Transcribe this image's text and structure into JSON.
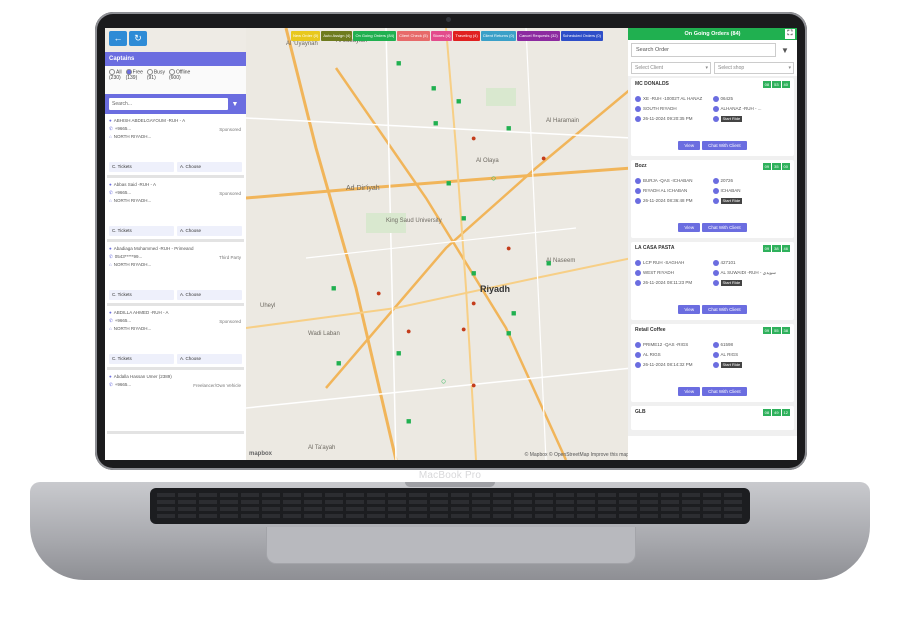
{
  "device": {
    "brand_label": "MacBook Pro"
  },
  "left_panel": {
    "back_icon": "arrow-left-icon",
    "refresh_icon": "refresh-icon",
    "title": "Captains",
    "filters": [
      {
        "label": "All",
        "count": "(230)"
      },
      {
        "label": "Free",
        "count": "(139)"
      },
      {
        "label": "Busy",
        "count": "(91)"
      },
      {
        "label": "Offline",
        "count": "(600)"
      }
    ],
    "search_placeholder": "Search...",
    "captains": [
      {
        "name": "ABHISH ABDELGAYOUM -RUH - A",
        "phone": "+9665...",
        "area": "NORTH RIYADH...",
        "right": "Sponsored",
        "action1": "C. Tickets",
        "action2": "A. Choose"
      },
      {
        "name": "Abbas Said -RUH - A",
        "phone": "+9665...",
        "area": "NORTH RIYADH...",
        "right": "Sponsored",
        "action1": "C. Tickets",
        "action2": "A. Choose"
      },
      {
        "name": "Abadiaga Mohammed -RUH - Primeand",
        "phone": "0543*****99...",
        "area": "NORTH RIYADH...",
        "right": "Third Party",
        "action1": "C. Tickets",
        "action2": "A. Choose"
      },
      {
        "name": "ABDILLA AHMED -RUH - A",
        "phone": "+9665...",
        "area": "NORTH RIYADH...",
        "right": "Sponsored",
        "action1": "C. Tickets",
        "action2": "A. Choose"
      },
      {
        "name": "Abdalla Hassan Umer (2389)",
        "phone": "+9665...",
        "area": "",
        "right": "Freelancer/Own Vehicle",
        "action1": "",
        "action2": ""
      }
    ]
  },
  "status_tabs": [
    {
      "label": "New Order (0)",
      "color": "#e8c81e"
    },
    {
      "label": "Auto Assign (4)",
      "color": "#6e7b1e"
    },
    {
      "label": "On Going Orders (84)",
      "color": "#20b050"
    },
    {
      "label": "Client Check (5)",
      "color": "#e76a6a"
    },
    {
      "label": "Stores (4)",
      "color": "#e34c8c"
    },
    {
      "label": "Traveling (4)",
      "color": "#e02020"
    },
    {
      "label": "Client Returns (0)",
      "color": "#3aa0c8"
    },
    {
      "label": "Cancel Requests (32)",
      "color": "#8c2aa0"
    },
    {
      "label": "Scheduled Orders (0)",
      "color": "#2e4ec8"
    }
  ],
  "map": {
    "city_label": "Riyadh",
    "place_labels": [
      "Al 'Uyaynah",
      "Al Jubaylah",
      "Ad Dir'iyah",
      "King Saud University",
      "Wadi Laban",
      "Al Ta'ayah",
      "Uheyl",
      "Al Haramain",
      "Al Olaya",
      "Al Naseem"
    ],
    "attribution": "© Mapbox © OpenStreetMap Improve this map",
    "logo": "mapbox"
  },
  "right_panel": {
    "title": "On Going Orders (84)",
    "fullscreen_icon": "fullscreen-icon",
    "search_placeholder": "Search Order",
    "filter_icon": "filter-icon",
    "select_client": "Select Client",
    "select_shop": "Select shop",
    "orders": [
      {
        "name": "MC DONALDS",
        "badges": [
          "08",
          "53",
          "40"
        ],
        "c1": "XE -RUH -10002T AL HANAZ",
        "c2": "06425",
        "c3": "SOUTH RIYADH",
        "c4": "ALHANAZ -RUH - ...",
        "c5": "26-11-2024 09:20:35 PM",
        "c6": "Start Ride",
        "view": "View",
        "chat": "Chat With Client"
      },
      {
        "name": "Bozz",
        "badges": [
          "09",
          "35",
          "00"
        ],
        "c1": "BURJA -QAS -ICHABAN",
        "c2": "20726",
        "c3": "RIYADH AL ICHABAN",
        "c4": "ICHABAN",
        "c5": "26-11-2024 08:36:48 PM",
        "c6": "Start Ride",
        "view": "View",
        "chat": "Chat With Client"
      },
      {
        "name": "LA CASA PASTA",
        "badges": [
          "09",
          "38",
          "46"
        ],
        "c1": "LCP RUH -SAGHAH",
        "c2": "427101",
        "c3": "WEST RIYADH",
        "c4": "AL SUWAIDI -RUH - سويدي",
        "c5": "26-11-2024 08:11:23 PM",
        "c6": "Start Ride",
        "view": "View",
        "chat": "Chat With Client"
      },
      {
        "name": "Retail Coffee",
        "badges": [
          "09",
          "55",
          "38"
        ],
        "c1": "PRIME12 -QAS -RIGS",
        "c2": "61598",
        "c3": "AL RIGS",
        "c4": "AL RIGS",
        "c5": "26-11-2024 08:14:32 PM",
        "c6": "Start Ride",
        "view": "View",
        "chat": "Chat With Client"
      },
      {
        "name": "GLB",
        "badges": [
          "08",
          "49",
          "12"
        ],
        "c1": "",
        "c2": "",
        "c3": "",
        "c4": "",
        "c5": "",
        "c6": "",
        "view": "",
        "chat": ""
      }
    ]
  }
}
